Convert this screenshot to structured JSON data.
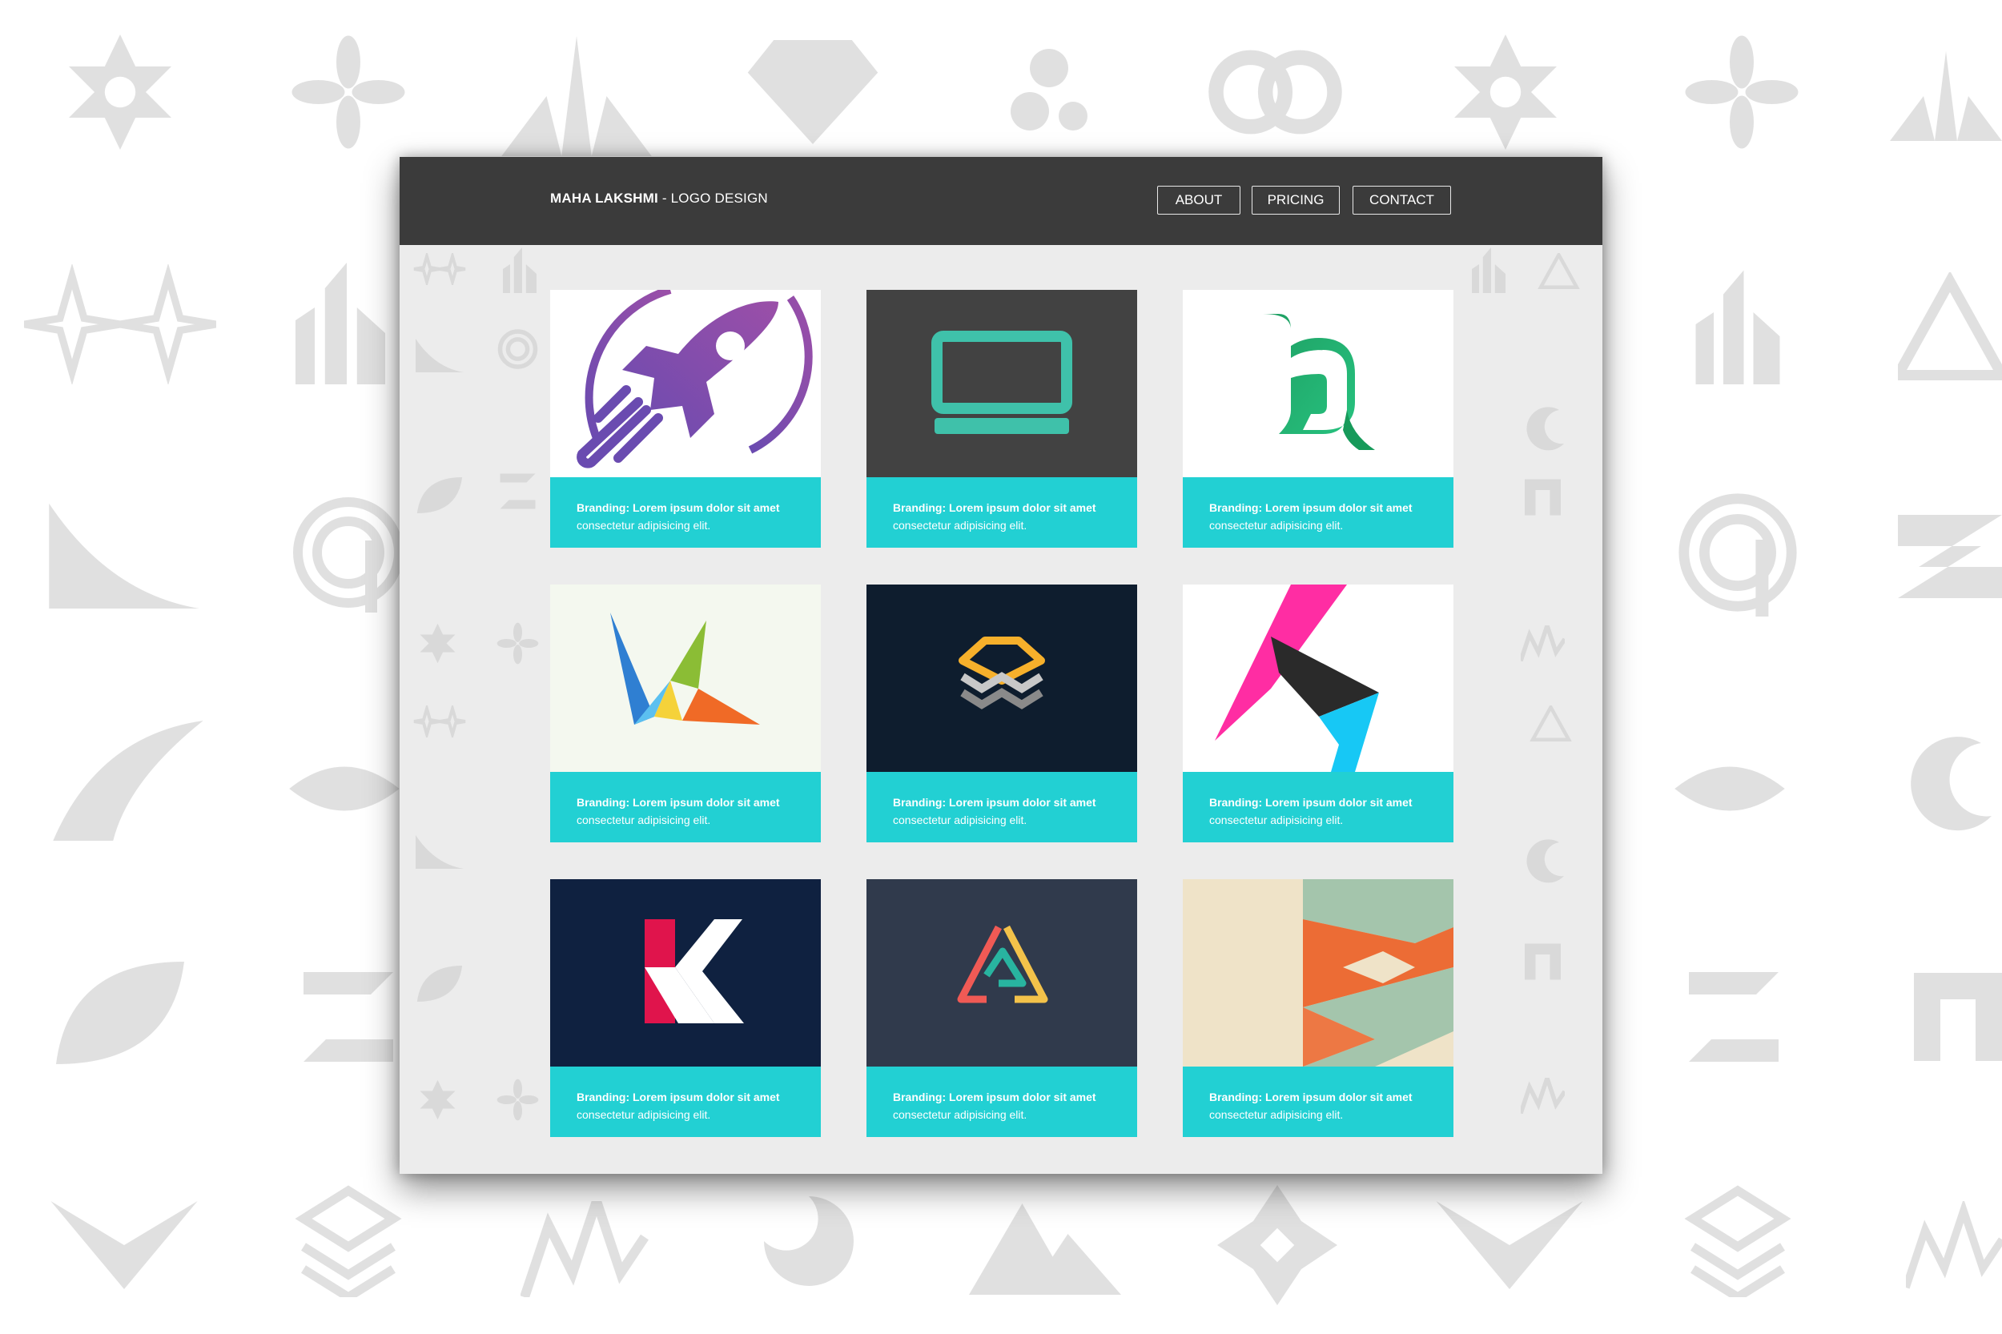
{
  "brand": {
    "name": "MAHA LAKSHMI",
    "suffix": " - LOGO DESIGN"
  },
  "nav": {
    "about": "ABOUT",
    "pricing": "PRICING",
    "contact": "CONTACT"
  },
  "colors": {
    "navbar": "#3b3b3b",
    "caption_bg": "#22d0d3",
    "page_bg": "#ececec"
  },
  "cards": [
    {
      "icon": "rocket-logo",
      "title": "Branding: Lorem ipsum dolor sit amet",
      "text": "consectetur adipisicing elit."
    },
    {
      "icon": "laptop-logo",
      "title": "Branding: Lorem ipsum dolor sit amet",
      "text": "consectetur adipisicing elit."
    },
    {
      "icon": "letter-b-logo",
      "title": "Branding: Lorem ipsum dolor sit amet",
      "text": "consectetur adipisicing elit."
    },
    {
      "icon": "bird-v-logo",
      "title": "Branding: Lorem ipsum dolor sit amet",
      "text": "consectetur adipisicing elit."
    },
    {
      "icon": "layers-logo",
      "title": "Branding: Lorem ipsum dolor sit amet",
      "text": "consectetur adipisicing elit."
    },
    {
      "icon": "letter-h-logo",
      "title": "Branding: Lorem ipsum dolor sit amet",
      "text": "consectetur adipisicing elit."
    },
    {
      "icon": "letter-k-logo",
      "title": "Branding: Lorem ipsum dolor sit amet",
      "text": "consectetur adipisicing elit."
    },
    {
      "icon": "triangle-logo",
      "title": "Branding: Lorem ipsum dolor sit amet",
      "text": "consectetur adipisicing elit."
    },
    {
      "icon": "geometric-hex-logo",
      "title": "Branding: Lorem ipsum dolor sit amet",
      "text": "consectetur adipisicing elit."
    }
  ]
}
